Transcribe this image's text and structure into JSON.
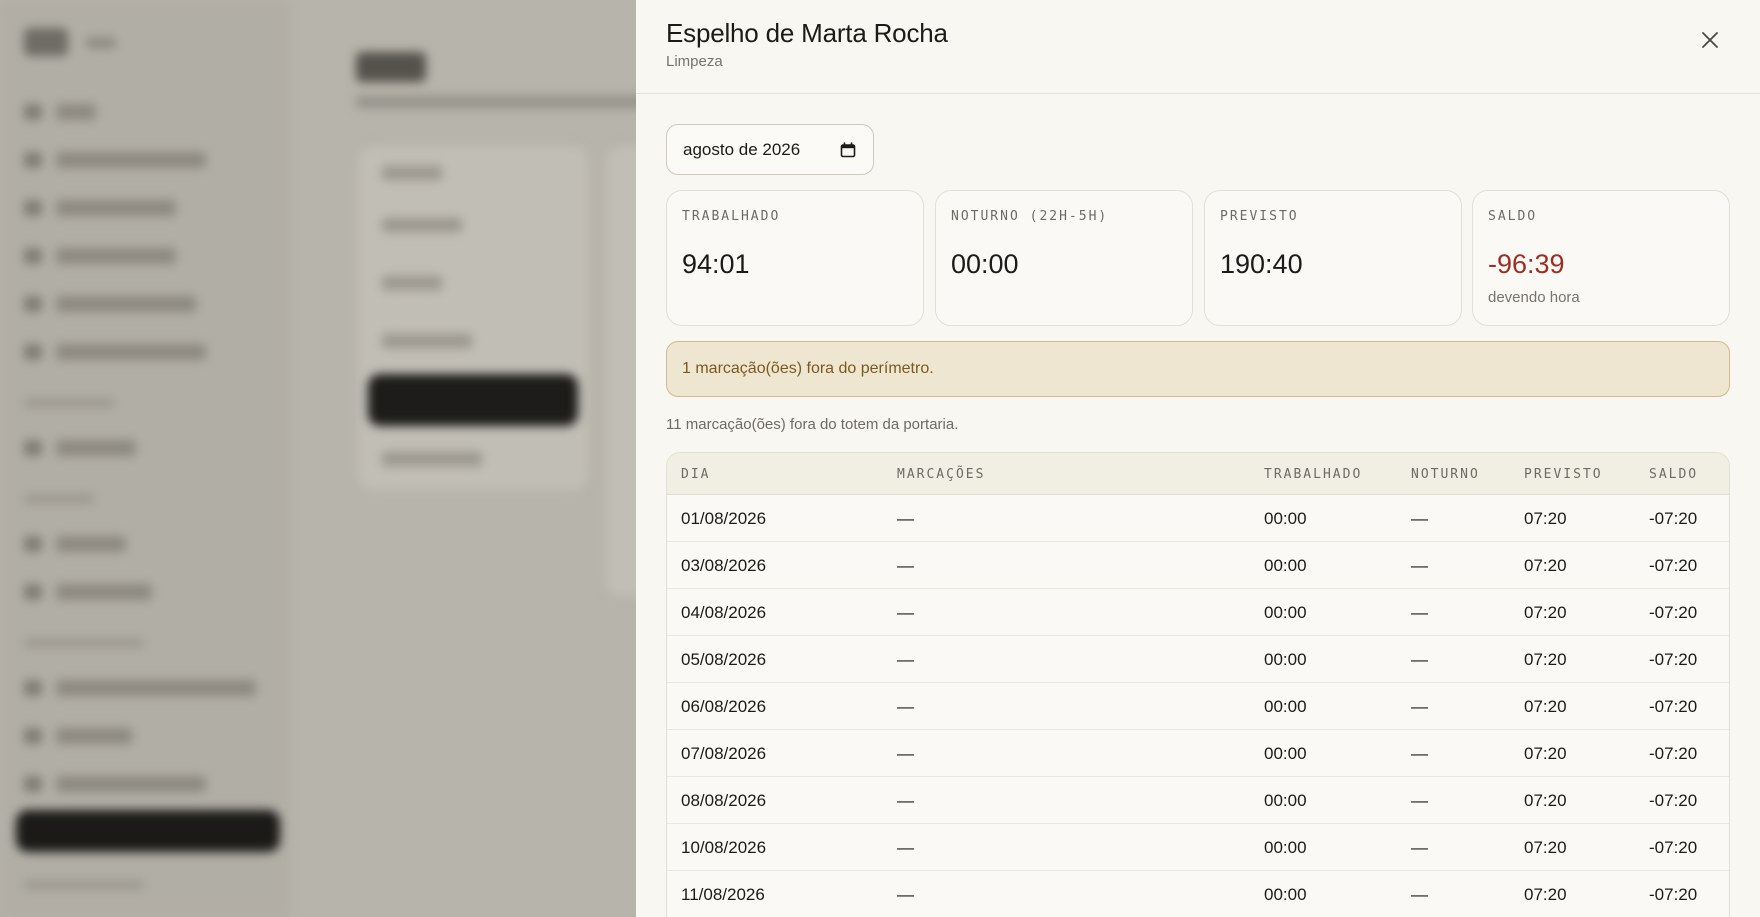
{
  "drawer": {
    "title": "Espelho de Marta Rocha",
    "subtitle": "Limpeza",
    "month_value": "agosto de 2026"
  },
  "stats": [
    {
      "label": "Trabalhado",
      "value": "94:01",
      "note": ""
    },
    {
      "label": "Noturno (22h-5h)",
      "value": "00:00",
      "note": ""
    },
    {
      "label": "Previsto",
      "value": "190:40",
      "note": ""
    },
    {
      "label": "Saldo",
      "value": "-96:39",
      "note": "devendo hora"
    }
  ],
  "alert": "1 marcação(ões) fora do perímetro.",
  "info": "11 marcação(ões) fora do totem da portaria.",
  "table": {
    "headers": [
      "Dia",
      "Marcações",
      "Trabalhado",
      "Noturno",
      "Previsto",
      "Saldo"
    ],
    "rows": [
      [
        "01/08/2026",
        "—",
        "00:00",
        "—",
        "07:20",
        "-07:20"
      ],
      [
        "03/08/2026",
        "—",
        "00:00",
        "—",
        "07:20",
        "-07:20"
      ],
      [
        "04/08/2026",
        "—",
        "00:00",
        "—",
        "07:20",
        "-07:20"
      ],
      [
        "05/08/2026",
        "—",
        "00:00",
        "—",
        "07:20",
        "-07:20"
      ],
      [
        "06/08/2026",
        "—",
        "00:00",
        "—",
        "07:20",
        "-07:20"
      ],
      [
        "07/08/2026",
        "—",
        "00:00",
        "—",
        "07:20",
        "-07:20"
      ],
      [
        "08/08/2026",
        "—",
        "00:00",
        "—",
        "07:20",
        "-07:20"
      ],
      [
        "10/08/2026",
        "—",
        "00:00",
        "—",
        "07:20",
        "-07:20"
      ],
      [
        "11/08/2026",
        "—",
        "00:00",
        "—",
        "07:20",
        "-07:20"
      ]
    ]
  },
  "colors": {
    "negative": "#9c2f22",
    "alert_bg": "#efe6d2",
    "alert_border": "#d2b88c",
    "alert_text": "#7a5a1c"
  },
  "icons": {
    "close": "close-icon",
    "calendar": "calendar-icon"
  }
}
